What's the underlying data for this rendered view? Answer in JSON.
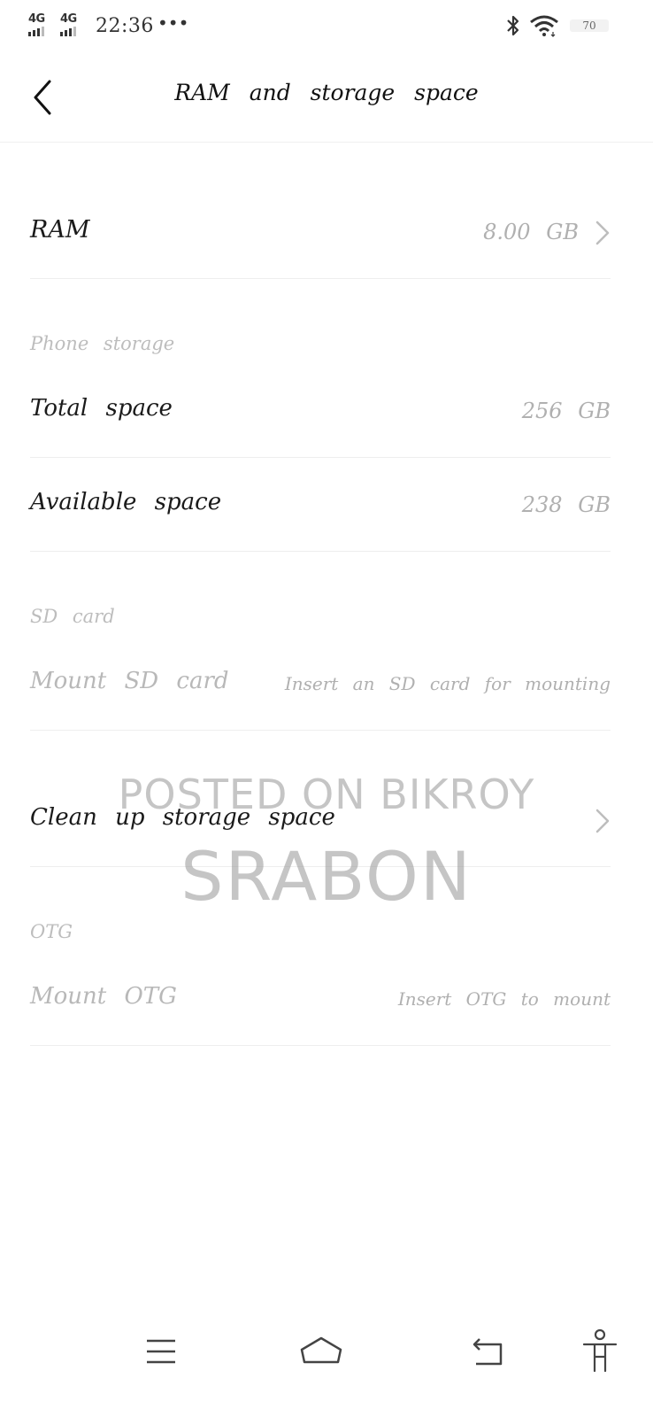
{
  "status_bar": {
    "sim1_label": "4G",
    "sim2_label": "4G",
    "time": "22:36",
    "more": "•••",
    "battery": "70",
    "icons": [
      "bluetooth-icon",
      "wifi-icon",
      "battery-icon"
    ]
  },
  "header": {
    "title": "RAM and storage space",
    "back_icon": "chevron-left-icon"
  },
  "ram": {
    "label": "RAM",
    "value": "8.00 GB"
  },
  "phone_storage": {
    "section_title": "Phone storage",
    "total": {
      "label": "Total space",
      "value": "256 GB"
    },
    "available": {
      "label": "Available space",
      "value": "238 GB"
    }
  },
  "sd_card": {
    "section_title": "SD card",
    "mount": {
      "label": "Mount SD card",
      "value": "Insert an SD card for mounting"
    }
  },
  "cleanup": {
    "label": "Clean up storage space"
  },
  "otg": {
    "section_title": "OTG",
    "mount": {
      "label": "Mount OTG",
      "value": "Insert OTG to mount"
    }
  },
  "watermark": {
    "line1": "POSTED ON BIKROY",
    "line2": "SRABON"
  },
  "nav_bar": {
    "icons": [
      "menu-icon",
      "home-icon",
      "back-icon",
      "accessibility-icon"
    ]
  }
}
